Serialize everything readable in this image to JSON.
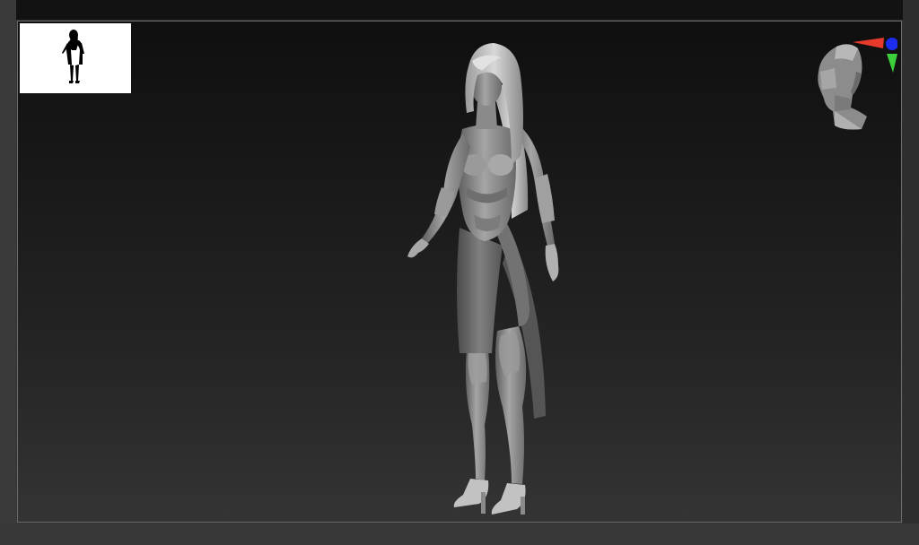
{
  "viewport": {
    "background_top": "#0f0f0f",
    "background_bottom": "#343434",
    "border_color": "#6a6a6a"
  },
  "thumbnail": {
    "icon": "silhouette-preview",
    "background": "#ffffff",
    "silhouette_color": "#000000"
  },
  "model": {
    "icon": "sculpt-figure",
    "material_color": "#8a8a8a"
  },
  "navigator": {
    "icon": "head-navigator",
    "axis_x_color": "#e53a2c",
    "axis_y_color": "#3ccf3c",
    "axis_z_color": "#1c2cf0"
  }
}
